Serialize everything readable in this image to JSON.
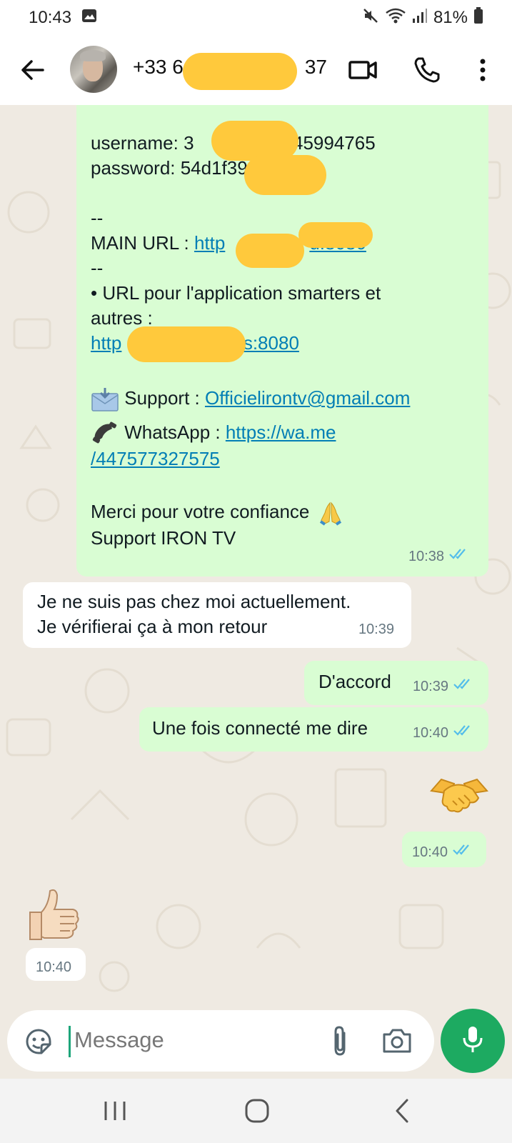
{
  "status": {
    "time": "10:43",
    "battery": "81%"
  },
  "header": {
    "contact_prefix": "+33 6",
    "contact_suffix": "37"
  },
  "messages": {
    "first": {
      "username_label": "username: 3",
      "username_tail": "445994765",
      "password_label": "password: 54d1f39f",
      "sep1": "--",
      "main_url_label": "MAIN URL : ",
      "main_url_head": "http",
      "main_url_tail": "u:8080",
      "sep2": "--",
      "app_line1": "• URL pour l'application smarters et",
      "app_line2": "autres :",
      "app_url_head": "http",
      "app_url_tail": "es:8080",
      "support_label": " Support : ",
      "support_email": "Officielirontv@gmail.com",
      "whatsapp_label": " WhatsApp : ",
      "whatsapp_url1": "https://wa.me",
      "whatsapp_url2": "/447577327575",
      "thanks": "Merci pour votre confiance",
      "signature": "Support IRON TV",
      "time": "10:38"
    },
    "second": {
      "line1": "Je ne suis pas chez moi actuellement.",
      "line2": "Je vérifierai ça à mon retour",
      "time": "10:39"
    },
    "third": {
      "text": "D'accord",
      "time": "10:39"
    },
    "fourth": {
      "text": "Une fois connecté me dire",
      "time": "10:40"
    },
    "fifth": {
      "time": "10:40"
    },
    "sixth": {
      "time": "10:40"
    }
  },
  "composer": {
    "placeholder": "Message"
  },
  "colors": {
    "accent": "#1daa61",
    "outgoing": "#d9fdd3",
    "link": "#027eb5",
    "read_tick": "#53bdeb",
    "redaction": "#ffc93c"
  },
  "icons": [
    "back-arrow-icon",
    "video-call-icon",
    "phone-icon",
    "more-vert-icon",
    "sticker-icon",
    "attach-icon",
    "camera-icon",
    "mic-icon",
    "recents-icon",
    "home-icon",
    "back-nav-icon"
  ]
}
